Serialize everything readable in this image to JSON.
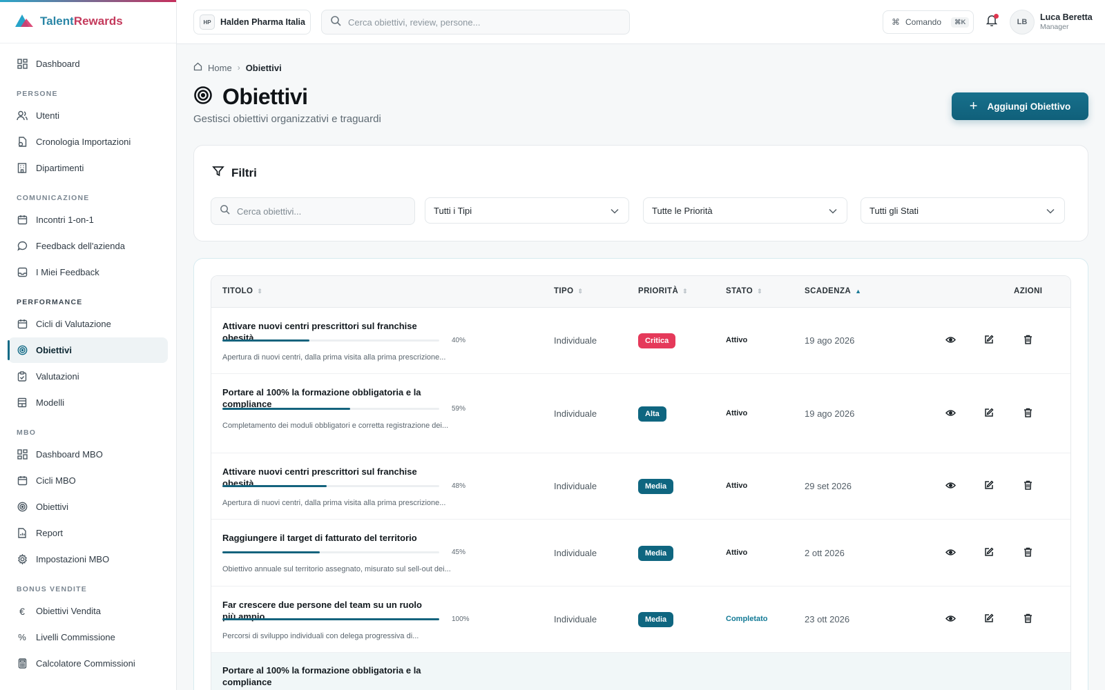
{
  "brand": {
    "name_part1": "Talent",
    "name_part2": "Rewards"
  },
  "sidebar": {
    "top_item": {
      "label": "Dashboard",
      "icon": "grid-icon"
    },
    "sections": [
      {
        "title": "PERSONE",
        "items": [
          {
            "label": "Utenti",
            "icon": "users-icon"
          },
          {
            "label": "Cronologia Importazioni",
            "icon": "file-history-icon"
          },
          {
            "label": "Dipartimenti",
            "icon": "building-icon"
          }
        ]
      },
      {
        "title": "COMUNICAZIONE",
        "items": [
          {
            "label": "Incontri 1-on-1",
            "icon": "calendar-icon"
          },
          {
            "label": "Feedback dell'azienda",
            "icon": "chat-icon"
          },
          {
            "label": "I Miei Feedback",
            "icon": "inbox-icon"
          }
        ]
      },
      {
        "title": "PERFORMANCE",
        "items": [
          {
            "label": "Cicli di Valutazione",
            "icon": "calendar-icon"
          },
          {
            "label": "Obiettivi",
            "icon": "target-icon",
            "active": true
          },
          {
            "label": "Valutazioni",
            "icon": "clipboard-check-icon"
          },
          {
            "label": "Modelli",
            "icon": "template-icon"
          }
        ]
      },
      {
        "title": "MBO",
        "items": [
          {
            "label": "Dashboard MBO",
            "icon": "grid-icon"
          },
          {
            "label": "Cicli MBO",
            "icon": "calendar-icon"
          },
          {
            "label": "Obiettivi",
            "icon": "target-icon"
          },
          {
            "label": "Report",
            "icon": "report-icon"
          },
          {
            "label": "Impostazioni MBO",
            "icon": "gear-icon"
          }
        ]
      },
      {
        "title": "BONUS VENDITE",
        "items": [
          {
            "label": "Obiettivi Vendita",
            "icon": "euro-icon"
          },
          {
            "label": "Livelli Commissione",
            "icon": "percent-icon"
          },
          {
            "label": "Calcolatore Commissioni",
            "icon": "calculator-icon"
          }
        ]
      }
    ]
  },
  "header": {
    "company_badge": "HP",
    "company_name": "Halden Pharma Italia",
    "search_placeholder": "Cerca obiettivi, review, persone...",
    "command_label": "Comando",
    "command_shortcut": "⌘K",
    "avatar_initials": "LB",
    "user_name": "Luca Beretta",
    "user_role": "Manager"
  },
  "breadcrumb": {
    "home": "Home",
    "current": "Obiettivi"
  },
  "page": {
    "title": "Obiettivi",
    "subtitle": "Gestisci obiettivi organizzativi e traguardi",
    "add_button": "Aggiungi Obiettivo"
  },
  "filters": {
    "title": "Filtri",
    "search_placeholder": "Cerca obiettivi...",
    "type_select": "Tutti i Tipi",
    "priority_select": "Tutte le Priorità",
    "status_select": "Tutti gli Stati"
  },
  "table": {
    "columns": {
      "title": "TITOLO",
      "type": "TIPO",
      "priority": "PRIORITÀ",
      "status": "STATO",
      "due": "SCADENZA",
      "actions": "AZIONI"
    },
    "sorted_column": "SCADENZA",
    "sort_direction": "asc",
    "rows": [
      {
        "title": "Attivare nuovi centri prescrittori sul franchise obesità",
        "progress": 40,
        "progress_label": "40%",
        "description": "Apertura di nuovi centri, dalla prima visita alla prima prescrizione...",
        "type": "Individuale",
        "priority": "Critica",
        "priority_color": "#e5395a",
        "status": "Attivo",
        "due": "19 ago 2026"
      },
      {
        "title": "Portare al 100% la formazione obbligatoria e la compliance",
        "progress": 59,
        "progress_label": "59%",
        "description": "Completamento dei moduli obbligatori e corretta registrazione dei...",
        "type": "Individuale",
        "priority": "Alta",
        "priority_color": "#0f6680",
        "status": "Attivo",
        "due": "19 ago 2026"
      },
      {
        "title": "Attivare nuovi centri prescrittori sul franchise obesità",
        "progress": 48,
        "progress_label": "48%",
        "description": "Apertura di nuovi centri, dalla prima visita alla prima prescrizione...",
        "type": "Individuale",
        "priority": "Media",
        "priority_color": "#0f6680",
        "status": "Attivo",
        "due": "29 set 2026"
      },
      {
        "title": "Raggiungere il target di fatturato del territorio",
        "progress": 45,
        "progress_label": "45%",
        "description": "Obiettivo annuale sul territorio assegnato, misurato sul sell-out dei...",
        "type": "Individuale",
        "priority": "Media",
        "priority_color": "#0f6680",
        "status": "Attivo",
        "due": "2 ott 2026"
      },
      {
        "title": "Far crescere due persone del team su un ruolo più ampio",
        "progress": 100,
        "progress_label": "100%",
        "description": "Percorsi di sviluppo individuali con delega progressiva di...",
        "type": "Individuale",
        "priority": "Media",
        "priority_color": "#0f6680",
        "status": "Completato",
        "due": "23 ott 2026"
      },
      {
        "title": "Portare al 100% la formazione obbligatoria e la compliance"
      }
    ]
  },
  "colors": {
    "accent": "#10607a",
    "critical": "#e5395a",
    "completed_text": "#137a96"
  }
}
